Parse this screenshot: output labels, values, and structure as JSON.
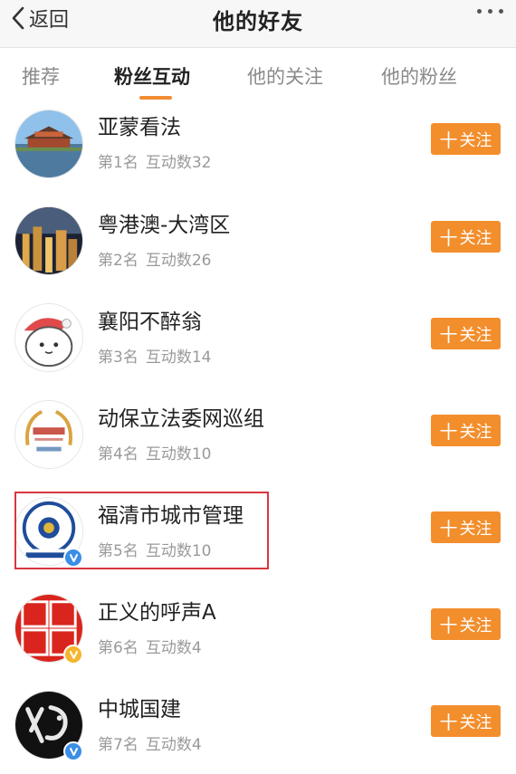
{
  "navbar": {
    "back_label": "返回",
    "title": "他的好友",
    "back_icon": "chevron-left-icon",
    "more_icon": "more-dots-icon"
  },
  "tabs": [
    {
      "label": "推荐",
      "active": false
    },
    {
      "label": "粉丝互动",
      "active": true
    },
    {
      "label": "他的关注",
      "active": false
    },
    {
      "label": "他的粉丝",
      "active": false
    }
  ],
  "colors": {
    "accent": "#f18c33",
    "follow_button": "#f38e2d",
    "highlight_border": "#d9363e",
    "verified_blue": "#3a8ee6",
    "verified_yellow": "#f5b52e"
  },
  "follow_label": "关注",
  "follow_plus": "十",
  "users": [
    {
      "name": "亚蒙看法",
      "rank": "第1名",
      "interactions": "互动数32",
      "verified": "none"
    },
    {
      "name": "粤港澳-大湾区",
      "rank": "第2名",
      "interactions": "互动数26",
      "verified": "none"
    },
    {
      "name": "襄阳不醉翁",
      "rank": "第3名",
      "interactions": "互动数14",
      "verified": "none"
    },
    {
      "name": "动保立法委网巡组",
      "rank": "第4名",
      "interactions": "互动数10",
      "verified": "none"
    },
    {
      "name": "福清市城市管理",
      "rank": "第5名",
      "interactions": "互动数10",
      "verified": "blue"
    },
    {
      "name": "正义的呼声A",
      "rank": "第6名",
      "interactions": "互动数4",
      "verified": "yellow"
    },
    {
      "name": "中城国建",
      "rank": "第7名",
      "interactions": "互动数4",
      "verified": "blue"
    }
  ]
}
